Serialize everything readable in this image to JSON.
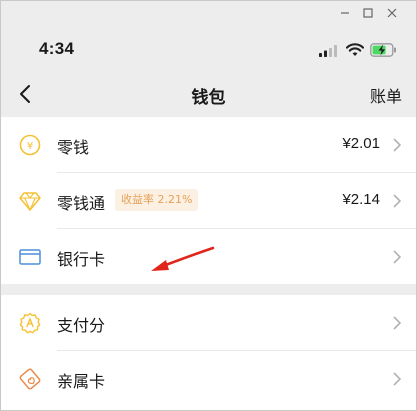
{
  "statusbar": {
    "time": "4:34"
  },
  "nav": {
    "title": "钱包",
    "action": "账单"
  },
  "items": [
    {
      "label": "零钱",
      "value": "¥2.01"
    },
    {
      "label": "零钱通",
      "badge": "收益率 2.21%",
      "value": "¥2.14"
    },
    {
      "label": "银行卡"
    },
    {
      "label": "支付分"
    },
    {
      "label": "亲属卡"
    }
  ],
  "colors": {
    "accent": "#f5c132",
    "arrow": "#e0261b",
    "bank": "#4b8fdc",
    "family": "#eb8a4b",
    "badge_text": "#e6a158"
  },
  "icons": [
    "coin-icon",
    "diamond-icon",
    "bank-card-icon",
    "pay-score-icon",
    "family-card-icon"
  ]
}
